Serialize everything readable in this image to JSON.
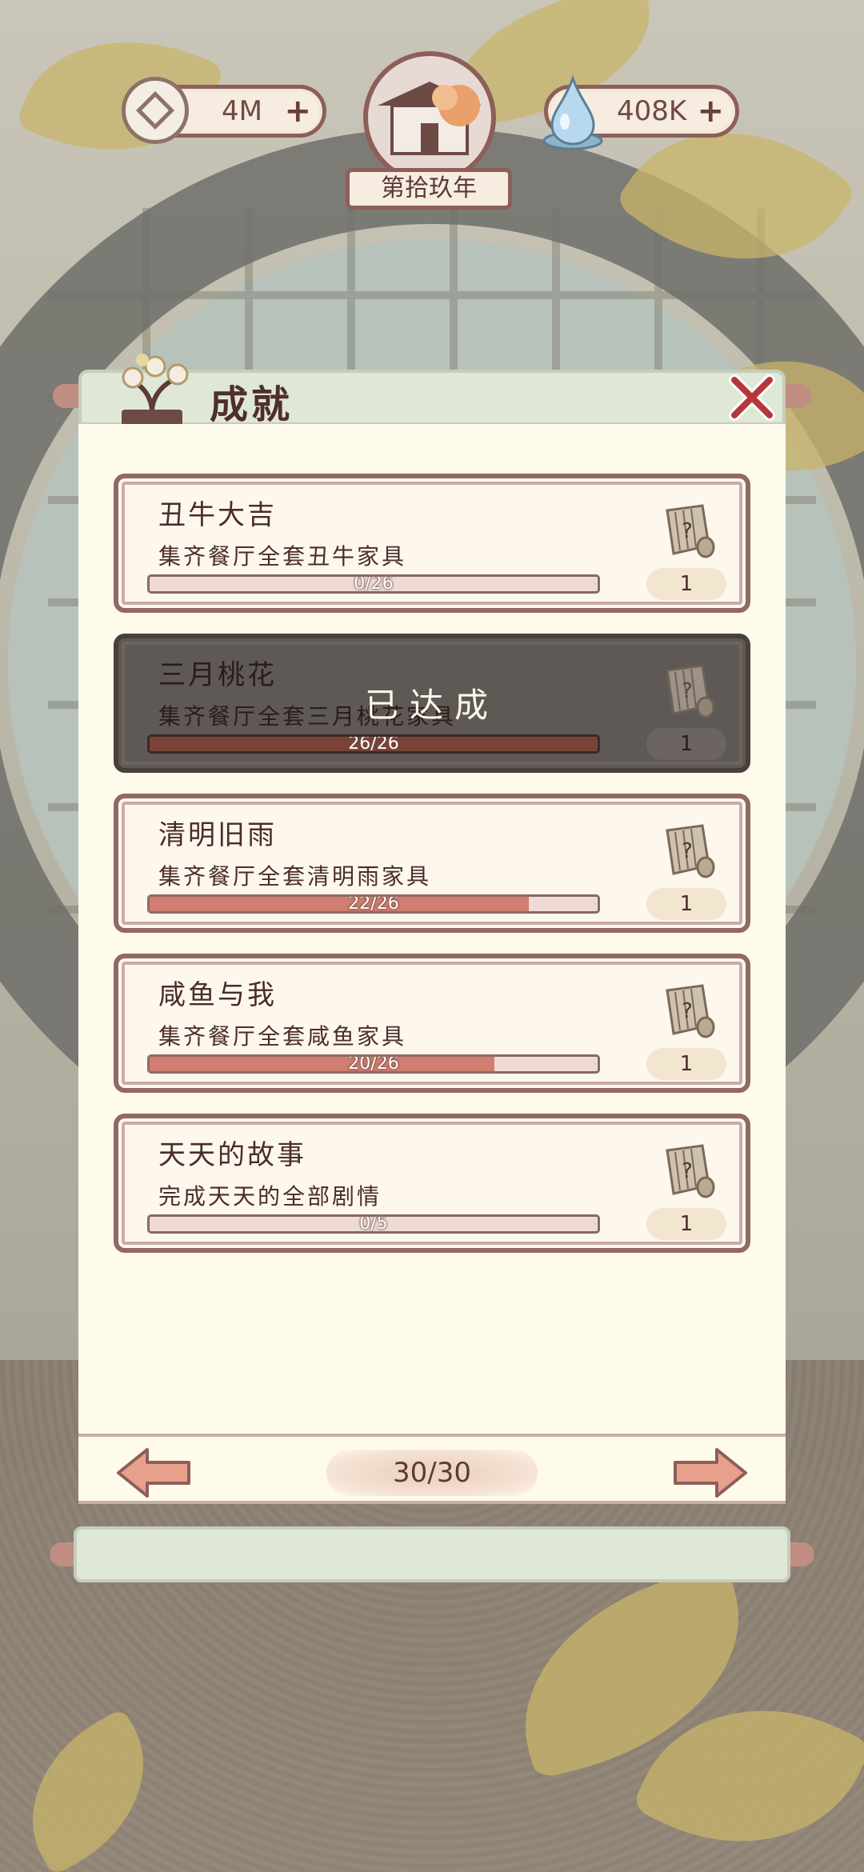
{
  "hud": {
    "coins": "4M",
    "jade": "408K",
    "year": "第拾玖年"
  },
  "dialog": {
    "title": "成就",
    "page_indicator": "30/30",
    "completed_label": "已达成"
  },
  "achievements": [
    {
      "title": "丑牛大吉",
      "desc": "集齐餐厅全套丑牛家具",
      "progress_text": "0/26",
      "progress": 0.0,
      "reward_count": "1",
      "completed": false
    },
    {
      "title": "三月桃花",
      "desc": "集齐餐厅全套三月桃花家具",
      "progress_text": "26/26",
      "progress": 1.0,
      "reward_count": "1",
      "completed": true
    },
    {
      "title": "清明旧雨",
      "desc": "集齐餐厅全套清明雨家具",
      "progress_text": "22/26",
      "progress": 0.846,
      "reward_count": "1",
      "completed": false
    },
    {
      "title": "咸鱼与我",
      "desc": "集齐餐厅全套咸鱼家具",
      "progress_text": "20/26",
      "progress": 0.769,
      "reward_count": "1",
      "completed": false
    },
    {
      "title": "天天的故事",
      "desc": "完成天天的全部剧情",
      "progress_text": "0/5",
      "progress": 0.0,
      "reward_count": "1",
      "completed": false
    }
  ],
  "colors": {
    "frame": "#8f6a62",
    "progress_fill": "#cf7e6f",
    "panel": "#fffbea",
    "header": "#dfe8d6"
  }
}
